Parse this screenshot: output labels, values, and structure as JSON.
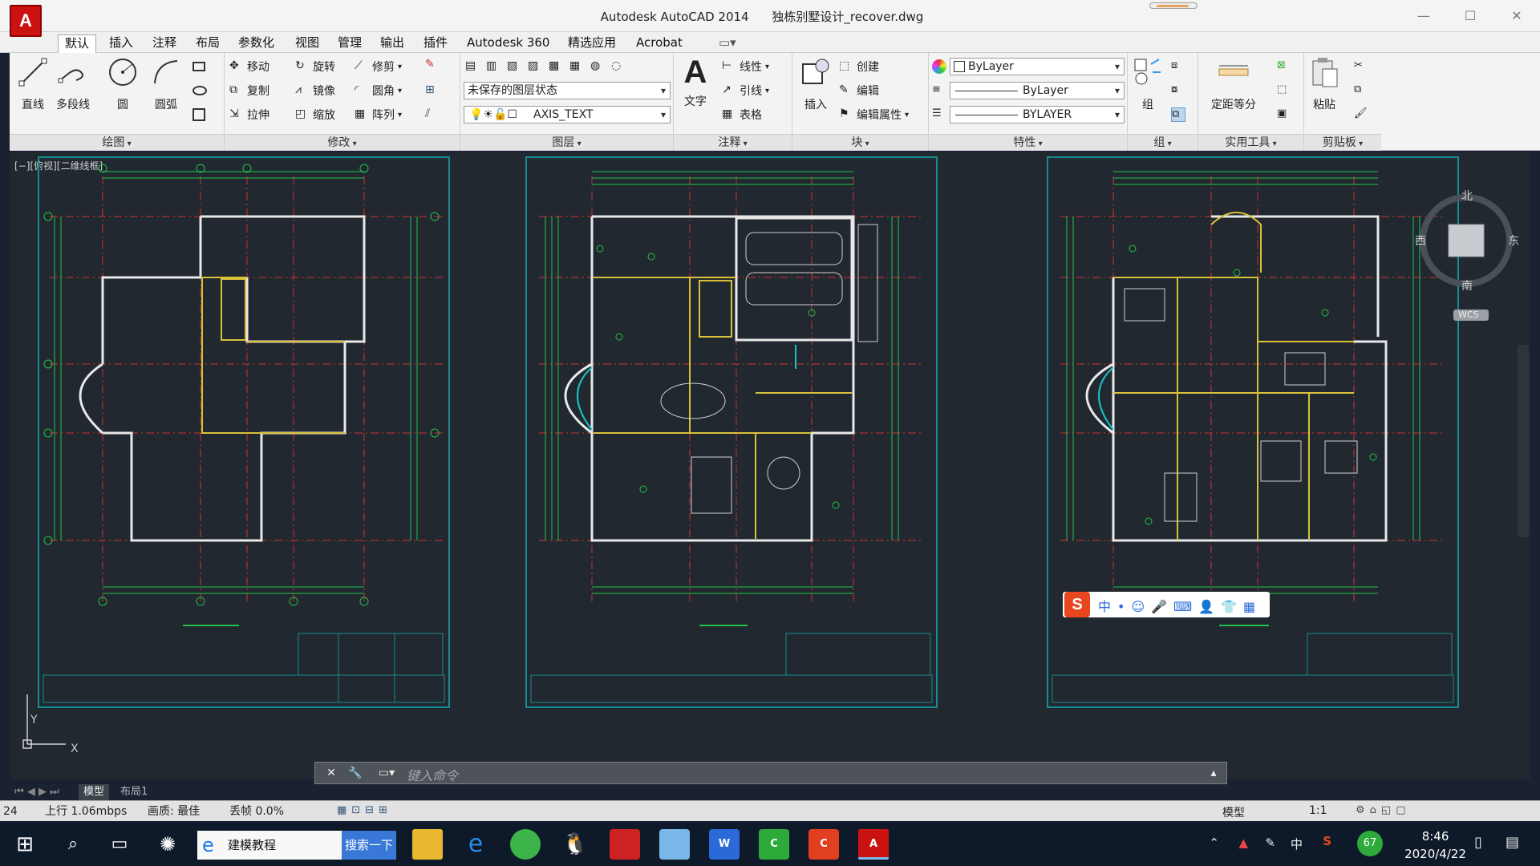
{
  "window": {
    "app_title": "Autodesk AutoCAD 2014",
    "file_title": "独栋别墅设计_recover.dwg",
    "minimize": "—",
    "maximize": "☐",
    "close": "✕"
  },
  "menu": {
    "tabs": [
      "默认",
      "插入",
      "注释",
      "布局",
      "参数化",
      "视图",
      "管理",
      "输出",
      "插件",
      "Autodesk 360",
      "精选应用",
      "Acrobat"
    ]
  },
  "ribbon": {
    "draw": {
      "title": "绘图",
      "line": "直线",
      "polyline": "多段线",
      "circle": "圆",
      "arc": "圆弧"
    },
    "modify": {
      "title": "修改",
      "move": "移动",
      "rotate": "旋转",
      "trim": "修剪",
      "copy": "复制",
      "mirror": "镜像",
      "fillet": "圆角",
      "stretch": "拉伸",
      "scale": "缩放",
      "array": "阵列"
    },
    "layers": {
      "title": "图层",
      "layer_state": "未保存的图层状态",
      "current_layer": "AXIS_TEXT"
    },
    "annotation": {
      "title": "注释",
      "text": "文字",
      "linear": "线性",
      "leader": "引线",
      "table": "表格"
    },
    "block": {
      "title": "块",
      "insert": "插入",
      "create": "创建",
      "edit": "编辑",
      "edit_attr": "编辑属性"
    },
    "properties": {
      "title": "特性",
      "color": "ByLayer",
      "linetype": "ByLayer",
      "lineweight": "BYLAYER"
    },
    "groups": {
      "title": "组",
      "group": "组"
    },
    "utilities": {
      "title": "实用工具",
      "measure": "定距等分"
    },
    "clipboard": {
      "title": "剪贴板",
      "paste": "粘贴"
    }
  },
  "viewport": {
    "label": "[−][俯视][二维线框]",
    "viewcube": {
      "north": "北",
      "south": "南",
      "east": "东",
      "west": "西",
      "wcs": "WCS"
    },
    "ucs_y": "Y",
    "ucs_x": "X"
  },
  "command": {
    "placeholder": "键入命令"
  },
  "layout_tabs": [
    "模型",
    "布局1"
  ],
  "status": {
    "coords": "24",
    "upload": "上行 1.06mbps",
    "quality": "画质: 最佳",
    "loss": "丢帧 0.0%",
    "model": "模型",
    "scale": "1:1"
  },
  "taskbar": {
    "search_app": "建模教程",
    "search_button": "搜索一下",
    "ime_zh": "中",
    "time": "8:46",
    "date": "2020/4/22",
    "battery": "67"
  },
  "colors": {
    "titlebar_bg": "#f4f4f4",
    "ribbon_bg": "#f3f3f3",
    "viewport_bg": "#212830",
    "sheet_border": "#178c91",
    "cad_green": "#22c24a",
    "cad_white": "#e8e8e8",
    "cad_yellow": "#d9c23a",
    "cad_red": "#d23030",
    "cad_cyan": "#19c2c8"
  }
}
